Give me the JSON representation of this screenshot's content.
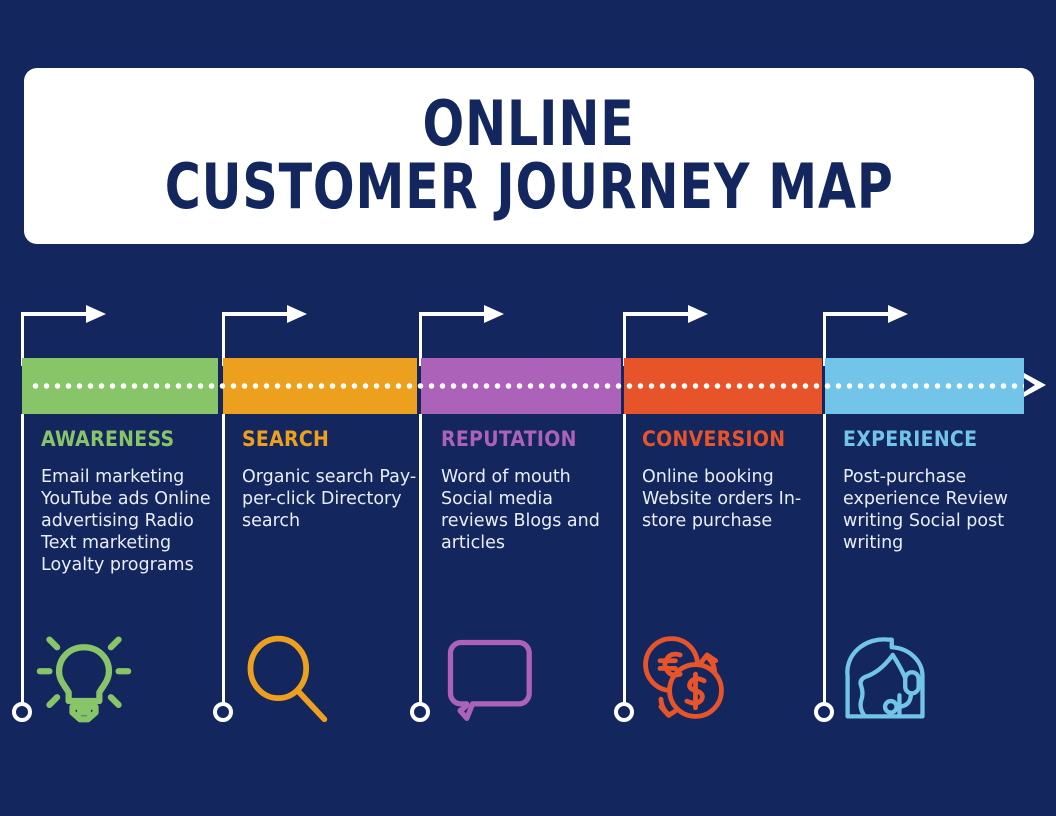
{
  "theme": {
    "background": "#13275e",
    "card_background": "#ffffff",
    "title_color": "#13275e",
    "rail_color": "#ffffff",
    "body_text_color": "#e9edf5"
  },
  "title": {
    "line1": "ONLINE",
    "line2": "CUSTOMER JOURNEY MAP"
  },
  "stages": [
    {
      "label": "AWARENESS",
      "color": "#87c568",
      "body": "Email marketing YouTube ads Online advertising Radio Text marketing Loyalty programs",
      "icon": "lightbulb-icon"
    },
    {
      "label": "SEARCH",
      "color": "#eda01e",
      "body": "Organic search Pay-per-click Directory search",
      "icon": "magnifier-icon"
    },
    {
      "label": "REPUTATION",
      "color": "#ac62b8",
      "body": "Word of mouth Social media reviews Blogs and articles",
      "icon": "speech-bubble-icon"
    },
    {
      "label": "CONVERSION",
      "color": "#e8542a",
      "body": "Online booking Website orders In-store purchase",
      "icon": "currency-exchange-icon"
    },
    {
      "label": "EXPERIENCE",
      "color": "#72c5e8",
      "body": "Post-purchase experience Review writing Social post writing",
      "icon": "headset-agent-icon"
    }
  ]
}
